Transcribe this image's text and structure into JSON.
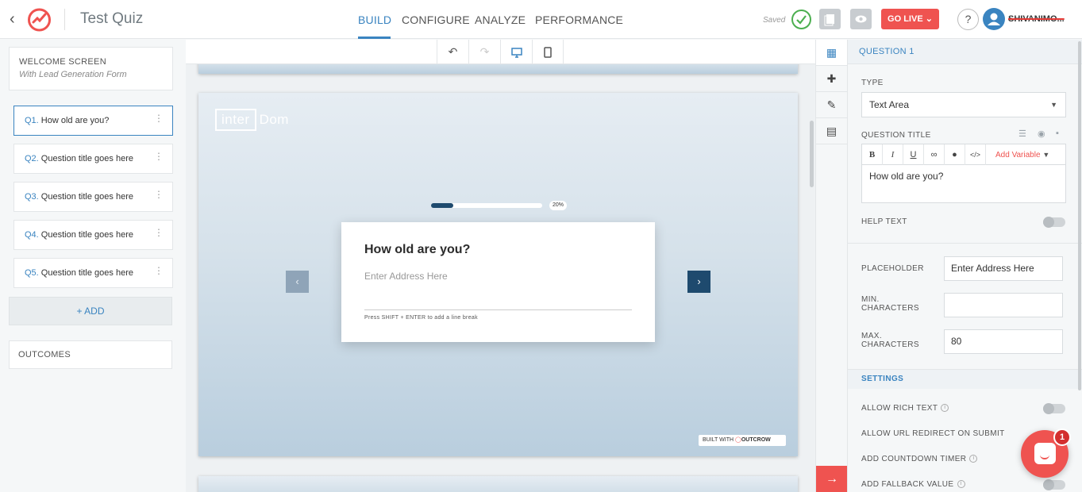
{
  "header": {
    "title": "Test Quiz",
    "tabs": [
      "BUILD",
      "CONFIGURE",
      "ANALYZE",
      "PERFORMANCE"
    ],
    "saved": "Saved",
    "go_live": "GO LIVE",
    "help": "?",
    "username": "SHIVANIMO...",
    "accent_color": "#3a84c0",
    "go_live_color": "#ef5350"
  },
  "left": {
    "welcome_title": "WELCOME SCREEN",
    "welcome_sub": "With Lead Generation Form",
    "questions": [
      {
        "num": "Q1.",
        "text": "How old are you?"
      },
      {
        "num": "Q2.",
        "text": "Question title goes here"
      },
      {
        "num": "Q3.",
        "text": "Question title goes here"
      },
      {
        "num": "Q4.",
        "text": "Question title goes here"
      },
      {
        "num": "Q5.",
        "text": "Question title goes here"
      }
    ],
    "add": "+ ADD",
    "outcomes": "OUTCOMES"
  },
  "preview": {
    "brand_box": "inter",
    "brand_dom": "Dom",
    "progress_pct": "20%",
    "progress_fraction": 0.2,
    "question": "How old are you?",
    "placeholder": "Enter Address Here",
    "hint": "Press SHIFT + ENTER to add a line break",
    "built_with": "BUILT WITH",
    "built_brand": "OUTCROW"
  },
  "right": {
    "header": "QUESTION 1",
    "type_label": "TYPE",
    "type_value": "Text Area",
    "qtitle_label": "QUESTION TITLE",
    "add_variable": "Add Variable",
    "qtitle_value": "How old are you?",
    "help_text": "HELP TEXT",
    "placeholder_label": "PLACEHOLDER",
    "placeholder_value": "Enter Address Here",
    "min_label_1": "MIN.",
    "min_label_2": "CHARACTERS",
    "min_value": "",
    "max_label_1": "MAX.",
    "max_label_2": "CHARACTERS",
    "max_value": "80",
    "settings": "SETTINGS",
    "allow_rich": "ALLOW RICH TEXT",
    "allow_redirect": "ALLOW URL REDIRECT ON SUBMIT",
    "countdown": "ADD COUNTDOWN TIMER",
    "fallback": "ADD FALLBACK VALUE"
  },
  "chat_badge": "1"
}
